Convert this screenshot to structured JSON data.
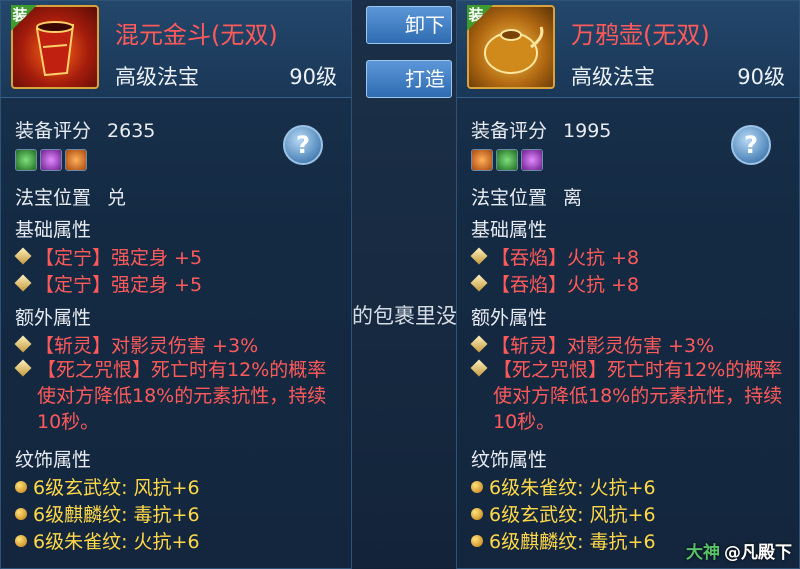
{
  "overlay": {
    "ghost_text": "的包裹里没",
    "buttons": {
      "unequip": "卸下",
      "forge": "打造"
    },
    "watermark": {
      "brand": "大神",
      "user": "@凡殿下"
    }
  },
  "left": {
    "badge": "装",
    "name": "混元金斗(无双)",
    "type": "高级法宝",
    "level": "90级",
    "score_label": "装备评分",
    "score": "2635",
    "position_label": "法宝位置",
    "position": "兑",
    "base_title": "基础属性",
    "base": [
      {
        "tag": "【定宁】",
        "text": "强定身 +5"
      },
      {
        "tag": "【定宁】",
        "text": "强定身 +5"
      }
    ],
    "extra_title": "额外属性",
    "extra1": {
      "tag": "【斩灵】",
      "text": "对影灵伤害 +3%"
    },
    "extra2": {
      "tag": "【死之咒恨】",
      "text": "死亡时有12%的概率使对方降低18%的元素抗性，持续10秒。"
    },
    "ornament_title": "纹饰属性",
    "ornaments": [
      "6级玄武纹: 风抗+6",
      "6级麒麟纹: 毒抗+6",
      "6级朱雀纹: 火抗+6"
    ]
  },
  "right": {
    "badge": "装",
    "name": "万鸦壶(无双)",
    "type": "高级法宝",
    "level": "90级",
    "score_label": "装备评分",
    "score": "1995",
    "position_label": "法宝位置",
    "position": "离",
    "base_title": "基础属性",
    "base": [
      {
        "tag": "【吞焰】",
        "text": "火抗 +8"
      },
      {
        "tag": "【吞焰】",
        "text": "火抗 +8"
      }
    ],
    "extra_title": "额外属性",
    "extra1": {
      "tag": "【斩灵】",
      "text": "对影灵伤害 +3%"
    },
    "extra2": {
      "tag": "【死之咒恨】",
      "text": "死亡时有12%的概率使对方降低18%的元素抗性，持续10秒。"
    },
    "ornament_title": "纹饰属性",
    "ornaments": [
      "6级朱雀纹: 火抗+6",
      "6级玄武纹: 风抗+6",
      "6级麒麟纹: 毒抗+6"
    ]
  },
  "colors": {
    "attr_red": "#ff5a5a",
    "ornament_gold": "#ffd84a",
    "panel_bg": "#142a43"
  }
}
